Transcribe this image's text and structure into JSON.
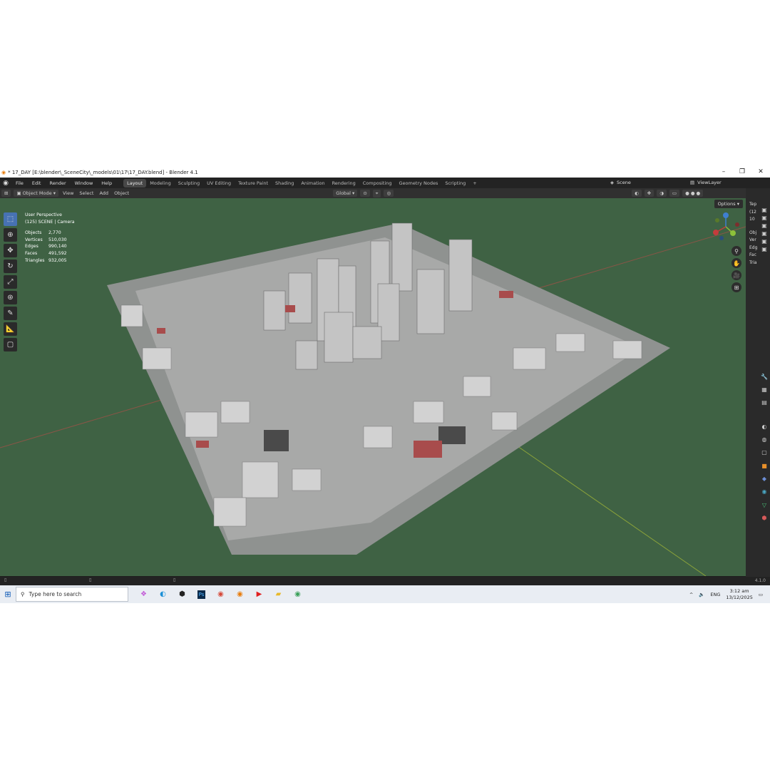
{
  "window": {
    "title": "* 17_DAY [E:\\blender\\_SceneCity\\_models\\01\\17\\17_DAY.blend] - Blender 4.1",
    "controls": [
      "–",
      "❐",
      "✕"
    ]
  },
  "menus": [
    "File",
    "Edit",
    "Render",
    "Window",
    "Help"
  ],
  "workspaces": [
    {
      "label": "Layout",
      "active": true
    },
    {
      "label": "Modeling"
    },
    {
      "label": "Sculpting"
    },
    {
      "label": "UV Editing"
    },
    {
      "label": "Texture Paint"
    },
    {
      "label": "Shading"
    },
    {
      "label": "Animation"
    },
    {
      "label": "Rendering"
    },
    {
      "label": "Compositing"
    },
    {
      "label": "Geometry Nodes"
    },
    {
      "label": "Scripting"
    }
  ],
  "add_workspace": "+",
  "scene": "Scene",
  "view_layer": "ViewLayer",
  "header": {
    "mode": "Object Mode",
    "view_menus": [
      "View",
      "Select",
      "Add",
      "Object"
    ],
    "transform_orientation": "Global",
    "options": "Options"
  },
  "overlay": {
    "line1": "User Perspective",
    "line2": "(125) SCENE | Camera",
    "stats": [
      {
        "label": "Objects",
        "value": "2,770"
      },
      {
        "label": "Vertices",
        "value": "510,030"
      },
      {
        "label": "Edges",
        "value": "990,140"
      },
      {
        "label": "Faces",
        "value": "491,592"
      },
      {
        "label": "Triangles",
        "value": "932,005"
      }
    ]
  },
  "outliner_fragments": [
    "Tep",
    "(12",
    "10",
    "Obj",
    "Ver",
    "Edg",
    "Fac",
    "Tria"
  ],
  "status_version": "4.1.0",
  "taskbar": {
    "search_placeholder": "Type here to search",
    "apps": [
      "copilot",
      "edge",
      "unity",
      "photoshop",
      "chrome",
      "blender",
      "youtube",
      "explorer",
      "chrome-profile"
    ],
    "tray": {
      "chevron": "^",
      "language": "ENG",
      "time": "3:12 am",
      "date": "13/12/2025"
    }
  },
  "colors": {
    "viewport_bg": "#3f6244",
    "active_tab": "#474747",
    "accent": "#4772b3",
    "x_axis": "#c43c3c",
    "y_axis": "#8cc23a",
    "z_axis": "#3f7fd0"
  }
}
